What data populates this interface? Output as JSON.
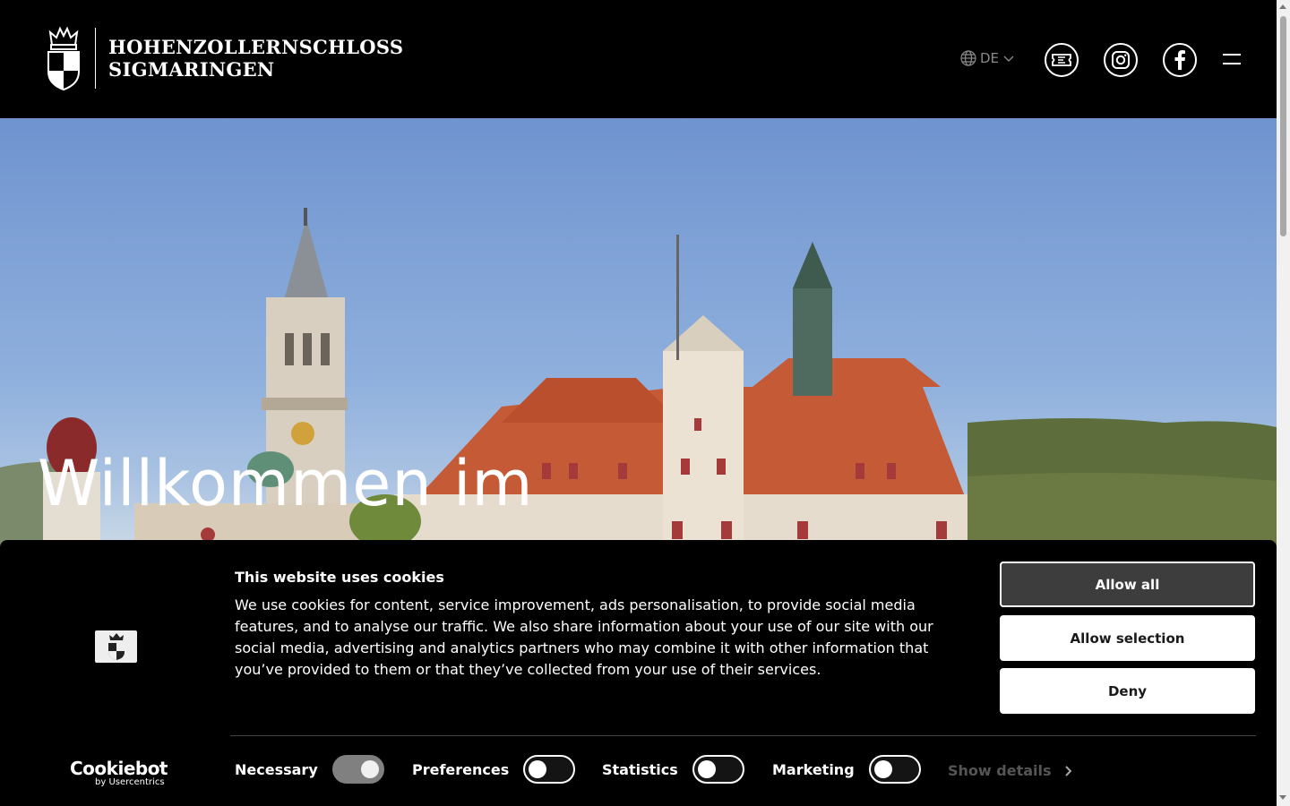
{
  "header": {
    "logo_line1": "HOHENZOLLERNSCHLOSS",
    "logo_line2": "SIGMARINGEN",
    "language": "DE",
    "icons": [
      "globe-icon",
      "chevron-down-icon",
      "ticket-icon",
      "instagram-icon",
      "facebook-icon",
      "hamburger-menu-icon"
    ]
  },
  "hero": {
    "title": "Willkommen im"
  },
  "cookie": {
    "title": "This website uses cookies",
    "text": "We use cookies for content, service improvement, ads personalisation, to provide social media features, and to analyse our traffic. We also share information about your use of our site with our social media, advertising and analytics partners who may combine it with other information that you’ve provided to them or that they’ve collected from your use of their services.",
    "buttons": {
      "allow_all": "Allow all",
      "allow_selection": "Allow selection",
      "deny": "Deny"
    },
    "toggles": [
      {
        "label": "Necessary",
        "checked": true,
        "disabled": true
      },
      {
        "label": "Preferences",
        "checked": false
      },
      {
        "label": "Statistics",
        "checked": false
      },
      {
        "label": "Marketing",
        "checked": false
      }
    ],
    "show_details": "Show details",
    "brand": "Cookiebot",
    "brand_sub": "by Usercentrics"
  },
  "colors": {
    "header_bg": "#000000",
    "primary_button": "#3d3d3d",
    "toggle_disabled": "#808080"
  }
}
